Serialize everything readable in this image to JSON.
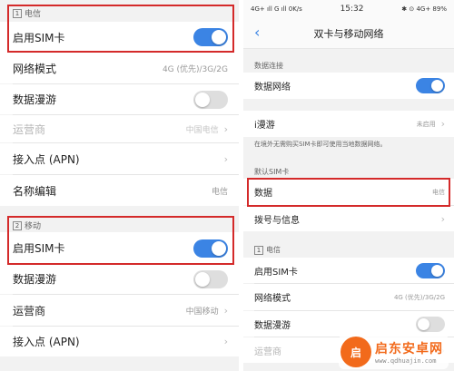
{
  "left": {
    "telecom_section": {
      "badge": "1",
      "title": "电信"
    },
    "telecom_rows": [
      {
        "label": "启用SIM卡",
        "type": "toggle",
        "state": "on"
      },
      {
        "label": "网络模式",
        "value": "4G (优先)/3G/2G"
      },
      {
        "label": "数据漫游",
        "type": "toggle",
        "state": "off"
      },
      {
        "label": "运营商",
        "value": "中国电信",
        "chevron": "›",
        "disabled": true
      },
      {
        "label": "接入点 (APN)",
        "chevron": "›"
      },
      {
        "label": "名称编辑",
        "value": "电信"
      }
    ],
    "mobile_section": {
      "badge": "2",
      "title": "移动"
    },
    "mobile_rows": [
      {
        "label": "启用SIM卡",
        "type": "toggle",
        "state": "on"
      },
      {
        "label": "数据漫游",
        "type": "toggle",
        "state": "off"
      },
      {
        "label": "运营商",
        "value": "中国移动",
        "chevron": "›"
      },
      {
        "label": "接入点 (APN)",
        "chevron": "›"
      }
    ]
  },
  "right": {
    "status_bar": {
      "signal_left": "4G+ ıll G ıll 0K/s",
      "time": "15:32",
      "signal_right": "✱ ⊙ 4G+ 89%"
    },
    "title": "双卡与移动网络",
    "back_icon": "‹",
    "sections": {
      "data_connection": "数据连接",
      "default_sim": "默认SIM卡",
      "telecom": {
        "badge": "1",
        "title": "电信"
      }
    },
    "rows": {
      "mobile_data": {
        "label": "数据网络",
        "state": "on"
      },
      "iroaming": {
        "label": "i漫游",
        "value": "未启用",
        "chevron": "›"
      },
      "iroaming_note": "在境外无需购买SIM卡即可使用当地数据网络。",
      "data": {
        "label": "数据",
        "value": "电信"
      },
      "dial": {
        "label": "拨号与信息",
        "chevron": "›"
      },
      "enable_sim": {
        "label": "启用SIM卡",
        "state": "on"
      },
      "network_mode": {
        "label": "网络模式",
        "value": "4G (优先)/3G/2G"
      },
      "data_roaming": {
        "label": "数据漫游",
        "state": "off"
      },
      "carrier": {
        "label": "运营商",
        "chevron": "›"
      }
    }
  },
  "watermark": {
    "logo_text": "启",
    "title": "启东安卓网",
    "url": "www.qdhuajin.com"
  },
  "colors": {
    "accent": "#3b84e4",
    "highlight": "#d42a2a",
    "background": "#f2f2f2"
  }
}
